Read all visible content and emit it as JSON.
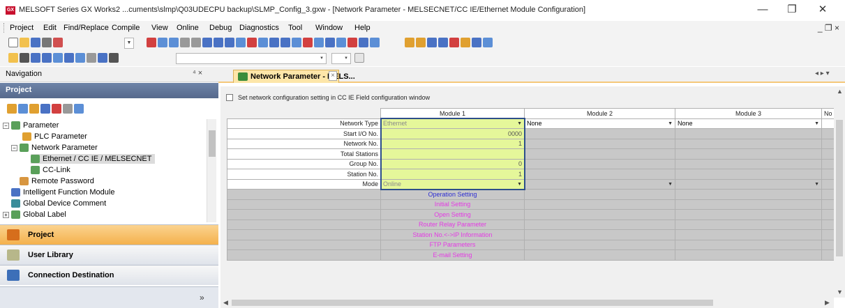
{
  "window": {
    "title": "MELSOFT Series GX Works2 ...cuments\\slmp\\Q03UDECPU backup\\SLMP_Config_3.gxw - [Network Parameter - MELSECNET/CC IE/Ethernet Module Configuration]",
    "app_icon_text": "GX",
    "minimize": "—",
    "restore": "❐",
    "close": "✕",
    "mdi_controls": "_ ❐ ×"
  },
  "menu": [
    {
      "label": "Project"
    },
    {
      "label": "Edit"
    },
    {
      "label": "Find/Replace"
    },
    {
      "label": "Compile"
    },
    {
      "label": "View"
    },
    {
      "label": "Online"
    },
    {
      "label": "Debug"
    },
    {
      "label": "Diagnostics"
    },
    {
      "label": "Tool"
    },
    {
      "label": "Window"
    },
    {
      "label": "Help"
    }
  ],
  "navigation": {
    "title": "Navigation",
    "pin": "⁴ ×",
    "section": "Project",
    "tree": [
      {
        "label": "Parameter",
        "level": 0,
        "expander": "−"
      },
      {
        "label": "PLC Parameter",
        "level": 1,
        "expander": ""
      },
      {
        "label": "Network Parameter",
        "level": 1,
        "expander": "−"
      },
      {
        "label": "Ethernet / CC IE / MELSECNET",
        "level": 2,
        "expander": ""
      },
      {
        "label": "CC-Link",
        "level": 2,
        "expander": ""
      },
      {
        "label": "Remote Password",
        "level": 1,
        "expander": ""
      },
      {
        "label": "Intelligent Function Module",
        "level": 0,
        "expander": "+"
      },
      {
        "label": "Global Device Comment",
        "level": 0,
        "expander": ""
      },
      {
        "label": "Global Label",
        "level": 0,
        "expander": "+"
      }
    ],
    "buttons": [
      {
        "label": "Project"
      },
      {
        "label": "User Library"
      },
      {
        "label": "Connection Destination"
      }
    ],
    "more": "»"
  },
  "tab": {
    "label": "Network Parameter - MELS...",
    "close": "×",
    "nav_arrows": "◂ ▸ ▾"
  },
  "config": {
    "checkbox_label": "Set network configuration setting in CC IE Field configuration window",
    "checkbox_checked": false,
    "columns": [
      "Module 1",
      "Module 2",
      "Module 3",
      "No"
    ],
    "rows": [
      {
        "label": "Network Type",
        "m1": "Ethernet",
        "m2": "None",
        "m3": "None"
      },
      {
        "label": "Start I/O No.",
        "m1": "0000"
      },
      {
        "label": "Network No.",
        "m1": "1"
      },
      {
        "label": "Total Stations",
        "m1": ""
      },
      {
        "label": "Group No.",
        "m1": "0"
      },
      {
        "label": "Station No.",
        "m1": "1"
      },
      {
        "label": "Mode",
        "m1": "Online"
      }
    ],
    "setting_buttons": [
      {
        "label": "Operation Setting",
        "color": "#2d2dd2"
      },
      {
        "label": "Initial Setting",
        "color": "#e43ae4"
      },
      {
        "label": "Open Setting",
        "color": "#e43ae4"
      },
      {
        "label": "Router Relay Parameter",
        "color": "#e43ae4"
      },
      {
        "label": "Station No.<->IP Information",
        "color": "#e43ae4"
      },
      {
        "label": "FTP Parameters",
        "color": "#e43ae4"
      },
      {
        "label": "E-mail Setting",
        "color": "#e43ae4"
      }
    ]
  },
  "colors": {
    "selected_cell": "#e5f79a",
    "selection_border": "#2d4f8a",
    "tab_active": "#fde6a9",
    "nav_header": "#56698c"
  }
}
